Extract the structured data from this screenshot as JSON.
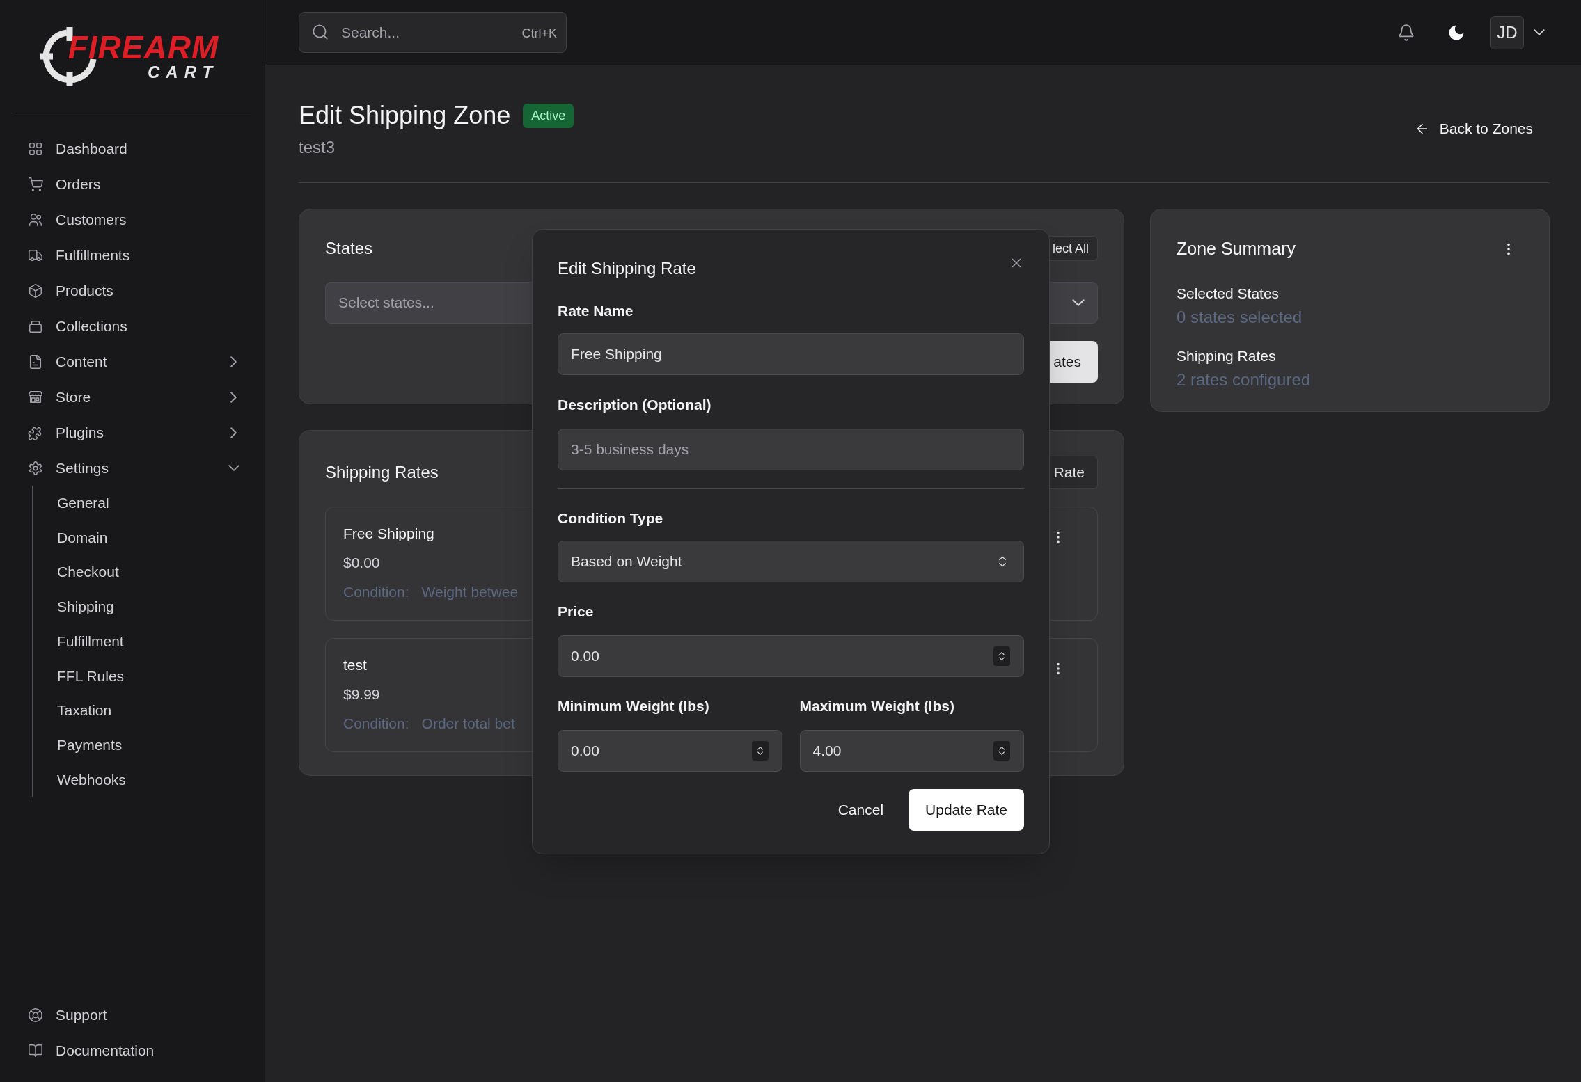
{
  "sidebar": {
    "logo": {
      "text": "FIREARM",
      "subtext": "CART"
    },
    "nav": [
      {
        "kind": "link",
        "label": "Dashboard"
      },
      {
        "kind": "link",
        "label": "Orders"
      },
      {
        "kind": "link",
        "label": "Customers"
      },
      {
        "kind": "link",
        "label": "Fulfillments"
      },
      {
        "kind": "link",
        "label": "Products"
      },
      {
        "kind": "link",
        "label": "Collections"
      },
      {
        "kind": "group",
        "label": "Content",
        "expanded": false
      },
      {
        "kind": "group",
        "label": "Store",
        "expanded": false
      },
      {
        "kind": "group",
        "label": "Plugins",
        "expanded": false
      },
      {
        "kind": "group",
        "label": "Settings",
        "expanded": true,
        "children": [
          {
            "label": "General"
          },
          {
            "label": "Domain"
          },
          {
            "label": "Checkout"
          },
          {
            "label": "Shipping"
          },
          {
            "label": "Fulfillment"
          },
          {
            "label": "FFL Rules"
          },
          {
            "label": "Taxation"
          },
          {
            "label": "Payments"
          },
          {
            "label": "Webhooks"
          }
        ]
      }
    ],
    "footer": [
      {
        "label": "Support"
      },
      {
        "label": "Documentation"
      }
    ]
  },
  "topbar": {
    "search": {
      "placeholder": "Search...",
      "shortcut": "Ctrl+K"
    },
    "avatar": "JD"
  },
  "page": {
    "title": "Edit Shipping Zone",
    "status": "Active",
    "subtitle": "test3",
    "back": "Back to Zones"
  },
  "states_card": {
    "title": "States",
    "select_all": "lect All",
    "select": {
      "placeholder": "Select states..."
    },
    "apply": "ates"
  },
  "rates_card": {
    "title": "Shipping Rates",
    "add": "Rate",
    "rates": [
      {
        "name": "Free Shipping",
        "price": "$0.00",
        "condition_label": "Condition:",
        "condition": "Weight betwee"
      },
      {
        "name": "test",
        "price": "$9.99",
        "condition_label": "Condition:",
        "condition": "Order total bet"
      }
    ]
  },
  "summary": {
    "title": "Zone Summary",
    "items": [
      {
        "label": "Selected States",
        "value": "0 states selected"
      },
      {
        "label": "Shipping Rates",
        "value": "2 rates configured"
      }
    ]
  },
  "modal": {
    "title": "Edit Shipping Rate",
    "rate_name": {
      "label": "Rate Name",
      "value": "Free Shipping"
    },
    "description": {
      "label": "Description (Optional)",
      "placeholder": "3-5 business days"
    },
    "condition_type": {
      "label": "Condition Type",
      "value": "Based on Weight"
    },
    "price": {
      "label": "Price",
      "value": "0.00"
    },
    "min_weight": {
      "label": "Minimum Weight (lbs)",
      "value": "0.00"
    },
    "max_weight": {
      "label": "Maximum Weight (lbs)",
      "value": "4.00"
    },
    "cancel": "Cancel",
    "submit": "Update Rate"
  }
}
